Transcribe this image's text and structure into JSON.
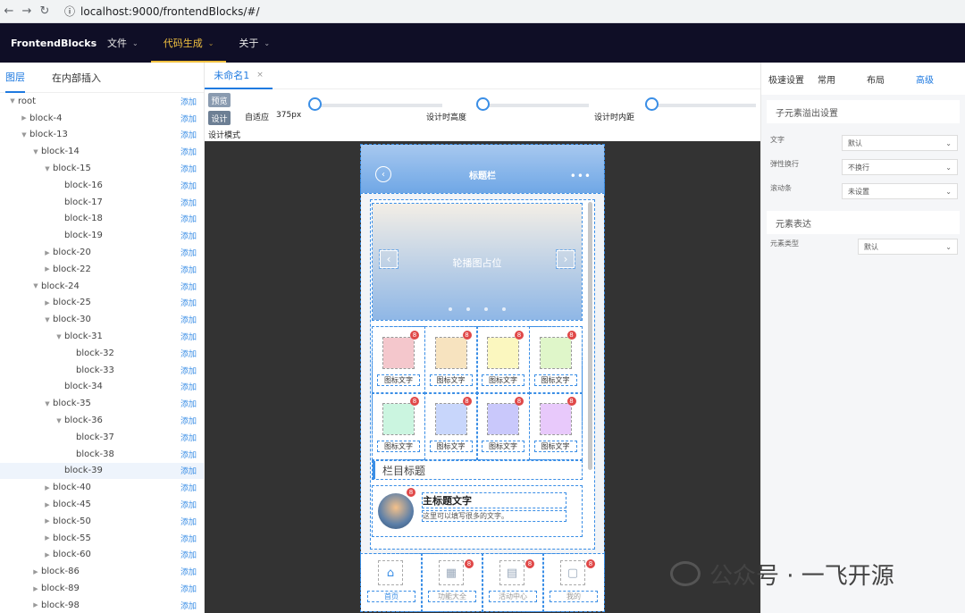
{
  "browser": {
    "url": "localhost:9000/frontendBlocks/#/"
  },
  "topnav": {
    "brand": "FrontendBlocks",
    "menus": [
      "文件",
      "代码生成",
      "关于"
    ],
    "active": "代码生成"
  },
  "left": {
    "tabs": [
      "图层",
      "在内部插入"
    ],
    "add_label": "添加",
    "tree": [
      {
        "label": "root",
        "caret": "down"
      },
      {
        "label": "block-4",
        "caret": "right"
      },
      {
        "label": "block-13",
        "caret": "down"
      },
      {
        "label": "block-14",
        "caret": "down"
      },
      {
        "label": "block-15",
        "caret": "down"
      },
      {
        "label": "block-16",
        "caret": ""
      },
      {
        "label": "block-17",
        "caret": ""
      },
      {
        "label": "block-18",
        "caret": ""
      },
      {
        "label": "block-19",
        "caret": ""
      },
      {
        "label": "block-20",
        "caret": "right"
      },
      {
        "label": "block-22",
        "caret": "right"
      },
      {
        "label": "block-24",
        "caret": "down"
      },
      {
        "label": "block-25",
        "caret": "right"
      },
      {
        "label": "block-30",
        "caret": "down"
      },
      {
        "label": "block-31",
        "caret": "down"
      },
      {
        "label": "block-32",
        "caret": ""
      },
      {
        "label": "block-33",
        "caret": ""
      },
      {
        "label": "block-34",
        "caret": ""
      },
      {
        "label": "block-35",
        "caret": "down"
      },
      {
        "label": "block-36",
        "caret": "down"
      },
      {
        "label": "block-37",
        "caret": ""
      },
      {
        "label": "block-38",
        "caret": ""
      },
      {
        "label": "block-39",
        "caret": "",
        "selected": true
      },
      {
        "label": "block-40",
        "caret": "right"
      },
      {
        "label": "block-45",
        "caret": "right"
      },
      {
        "label": "block-50",
        "caret": "right"
      },
      {
        "label": "block-55",
        "caret": "right"
      },
      {
        "label": "block-60",
        "caret": "right"
      },
      {
        "label": "block-86",
        "caret": "right"
      },
      {
        "label": "block-89",
        "caret": "right"
      },
      {
        "label": "block-98",
        "caret": "right"
      }
    ]
  },
  "center": {
    "tab": "未命名1",
    "preview_btn": "预览",
    "design_btn": "设计",
    "mode_label": "设计模式",
    "adapt_label": "自适应",
    "width_value": "375px",
    "height_label": "设计时高度",
    "padding_label": "设计时内距"
  },
  "phone": {
    "title": "标题栏",
    "banner": "轮播图占位",
    "icon_label": "图标文字",
    "badge": "8",
    "section_title": "栏目标题",
    "list_title": "主标题文字",
    "list_sub": "这里可以填写很多的文字。",
    "tabs": [
      "首页",
      "功能大全",
      "活动中心",
      "我的"
    ],
    "icon_colors": [
      "#f4c7cc",
      "#f7e3bf",
      "#fbf7bf",
      "#dff6c9",
      "#cbf5e0",
      "#c8d6fb",
      "#c9c8fb",
      "#e8c9fb"
    ]
  },
  "right": {
    "tabs": [
      "极速设置",
      "常用",
      "布局",
      "高级"
    ],
    "active_tab": "高级",
    "section1": "子元素溢出设置",
    "rows": [
      {
        "k": "文字",
        "v": "默认"
      },
      {
        "k": "弹性换行",
        "v": "不换行"
      },
      {
        "k": "滚动条",
        "v": "未设置"
      }
    ],
    "section2": "元素表达",
    "row_type": {
      "k": "元素类型",
      "v": "默认"
    }
  },
  "watermark": "公众号 · 一飞开源"
}
